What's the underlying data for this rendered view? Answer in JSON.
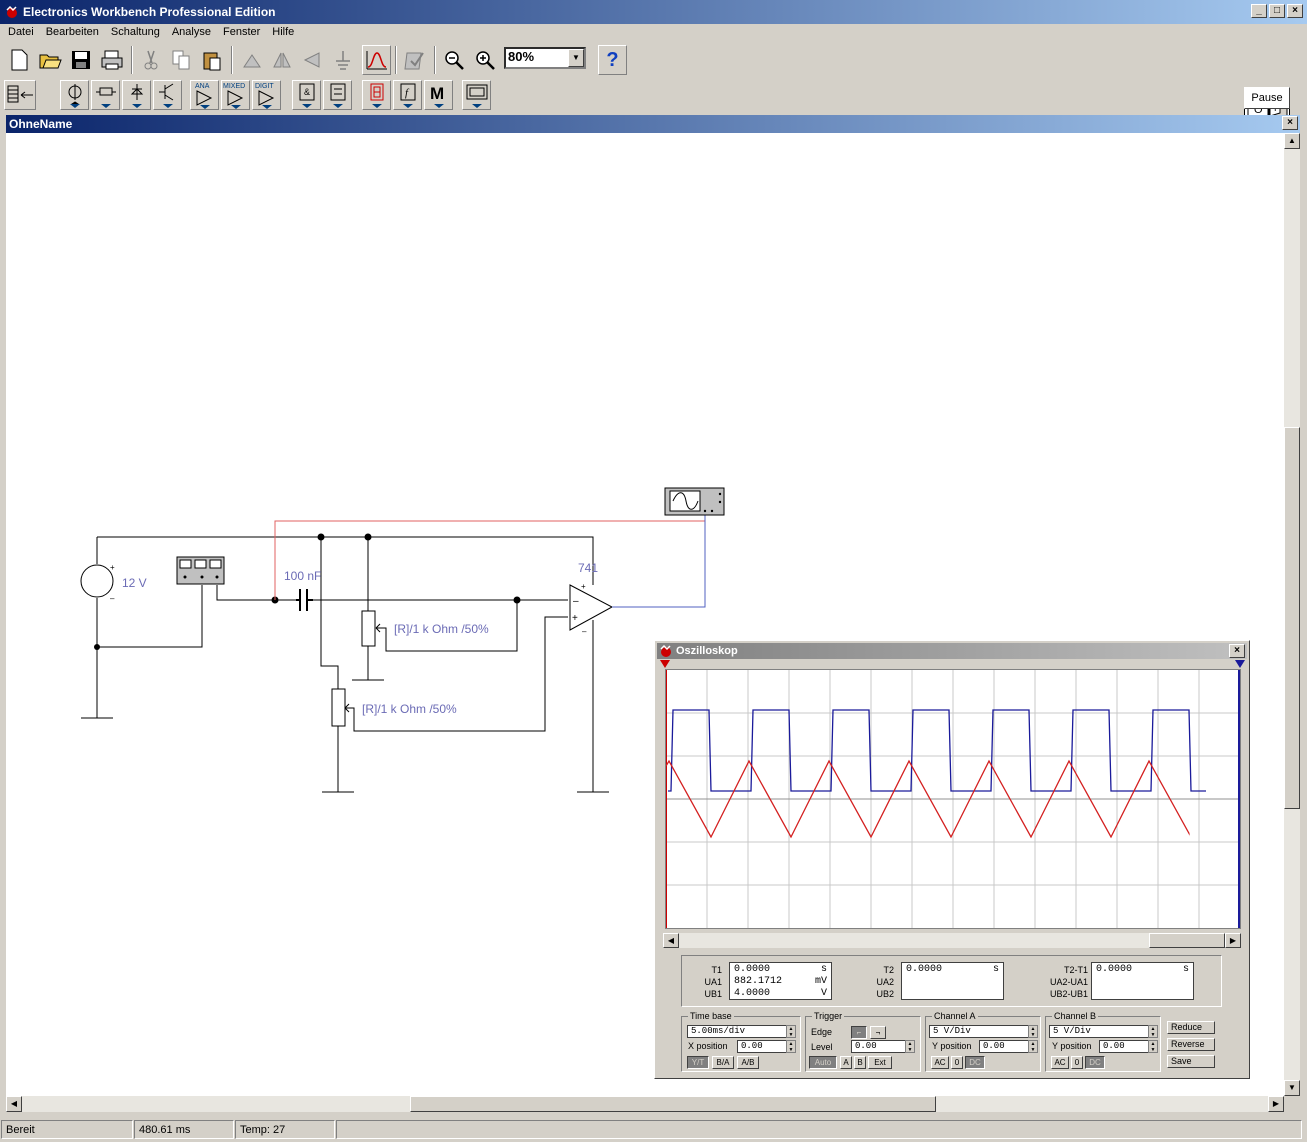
{
  "app": {
    "title": "Electronics Workbench Professional Edition"
  },
  "menu": [
    "Datei",
    "Bearbeiten",
    "Schaltung",
    "Analyse",
    "Fenster",
    "Hilfe"
  ],
  "toolbar": {
    "zoom": "80%",
    "help": "?",
    "pause": "Pause",
    "onoff": "O I",
    "ana": "ANA",
    "mixed": "MIXED",
    "digit": "DIGIT",
    "m": "M",
    "f": "f"
  },
  "document": {
    "title": "OhneName"
  },
  "circuit": {
    "source_label": "12 V",
    "cap_label": "100 nF",
    "opamp_label": "741",
    "pot1_label": "[R]/1 k Ohm /50%",
    "pot2_label": "[R]/1 k Ohm /50%"
  },
  "oscilloscope": {
    "title": "Oszilloskop",
    "readouts": {
      "t1_label": "T1",
      "t1": "0.0000",
      "t1_unit": "s",
      "ua1_label": "UA1",
      "ua1": "882.1712",
      "ua1_unit": "mV",
      "ub1_label": "UB1",
      "ub1": "4.0000",
      "ub1_unit": "V",
      "t2_label": "T2",
      "t2": "0.0000",
      "t2_unit": "s",
      "ua2_label": "UA2",
      "ub2_label": "UB2",
      "t2t1_label": "T2-T1",
      "t2t1": "0.0000",
      "t2t1_unit": "s",
      "ua2ua1_label": "UA2-UA1",
      "ub2ub1_label": "UB2-UB1"
    },
    "timebase": {
      "title": "Time base",
      "value": "5.00ms/div",
      "xpos_label": "X position",
      "xpos": "0.00",
      "yt": "Y/T",
      "ba": "B/A",
      "ab": "A/B"
    },
    "trigger": {
      "title": "Trigger",
      "edge_label": "Edge",
      "level_label": "Level",
      "level": "0.00",
      "auto": "Auto",
      "a": "A",
      "b": "B",
      "ext": "Ext"
    },
    "channel_a": {
      "title": "Channel A",
      "value": "5 V/Div",
      "ypos_label": "Y position",
      "ypos": "0.00",
      "ac": "AC",
      "zero": "0",
      "dc": "DC"
    },
    "channel_b": {
      "title": "Channel B",
      "value": "5 V/Div",
      "ypos_label": "Y position",
      "ypos": "0.00",
      "ac": "AC",
      "zero": "0",
      "dc": "DC"
    },
    "buttons": {
      "reduce": "Reduce",
      "reverse": "Reverse",
      "save": "Save"
    },
    "colors": {
      "channel_a": "#d42020",
      "channel_b": "#1a1a9a"
    }
  },
  "status": {
    "state": "Bereit",
    "time": "480.61 ms",
    "temp": "Temp:  27"
  }
}
